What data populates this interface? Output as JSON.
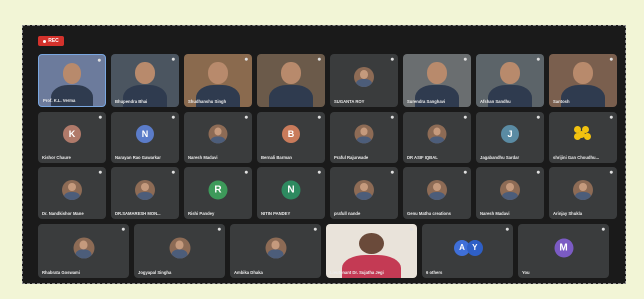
{
  "recording_label": "REC",
  "participants_row1": [
    {
      "name": "Prof. K.L. Verma",
      "kind": "video",
      "bg": "#6c7b9c",
      "active": true
    },
    {
      "name": "Bhupendra Bhai",
      "kind": "video",
      "bg": "#4b5560"
    },
    {
      "name": "Shudhanshu Singh",
      "kind": "video",
      "bg": "#8a6a4e"
    },
    {
      "name": "",
      "kind": "video",
      "bg": "#6b5a4a"
    },
    {
      "name": "SUGANTA ROY",
      "kind": "photo"
    },
    {
      "name": "Surendra Sanghavi",
      "kind": "video",
      "bg": "#6a6e70"
    },
    {
      "name": "Afshan Sandhu",
      "kind": "video",
      "bg": "#5c6469"
    },
    {
      "name": "Santosh",
      "kind": "video",
      "bg": "#7a5f4e"
    }
  ],
  "participants_row2": [
    {
      "name": "Kishor Chaure",
      "kind": "initial",
      "initial": "K",
      "color": "#b07a6a"
    },
    {
      "name": "Narayan Rao Gawarkar",
      "kind": "initial",
      "initial": "N",
      "color": "#5b7cc9"
    },
    {
      "name": "Naresh Madavi",
      "kind": "photo"
    },
    {
      "name": "Bernali Barman",
      "kind": "initial",
      "initial": "B",
      "color": "#c97b5b"
    },
    {
      "name": "Praful Rajurwade",
      "kind": "photo"
    },
    {
      "name": "DR ASIF IQBAL",
      "kind": "photo"
    },
    {
      "name": "Jagabandhu Sardar",
      "kind": "initial",
      "initial": "J",
      "color": "#5a8ba3"
    },
    {
      "name": "shrijini Gan Choudhu...",
      "kind": "flower"
    }
  ],
  "participants_row3": [
    {
      "name": "Dr. Nandkishor Mane",
      "kind": "photo"
    },
    {
      "name": "DR.SAMARESH MON...",
      "kind": "photo"
    },
    {
      "name": "Rishi Pandey",
      "kind": "initial",
      "initial": "R",
      "color": "#3d9a5a"
    },
    {
      "name": "NITIN PANDEY",
      "kind": "initial",
      "initial": "N",
      "color": "#2e8a60"
    },
    {
      "name": "prafull nande",
      "kind": "photo"
    },
    {
      "name": "Genu Mathu creations",
      "kind": "photo"
    },
    {
      "name": "Naresh Madavi",
      "kind": "photo"
    },
    {
      "name": "Arinjay Shukla",
      "kind": "photo"
    }
  ],
  "participants_row4": [
    {
      "name": "Rhabrata Goswami",
      "kind": "photo"
    },
    {
      "name": "Jogyapal Singha",
      "kind": "photo"
    },
    {
      "name": "Ambika Dhaka",
      "kind": "photo"
    },
    {
      "name": "Lieutenant Dr. Sujatha Jegi",
      "kind": "video",
      "bg": "#e9e3da"
    },
    {
      "name": "6 others",
      "kind": "others"
    },
    {
      "name": "You",
      "kind": "initial",
      "initial": "M",
      "color": "#7b5bc4"
    }
  ],
  "others_initials": [
    "A",
    "Y"
  ]
}
